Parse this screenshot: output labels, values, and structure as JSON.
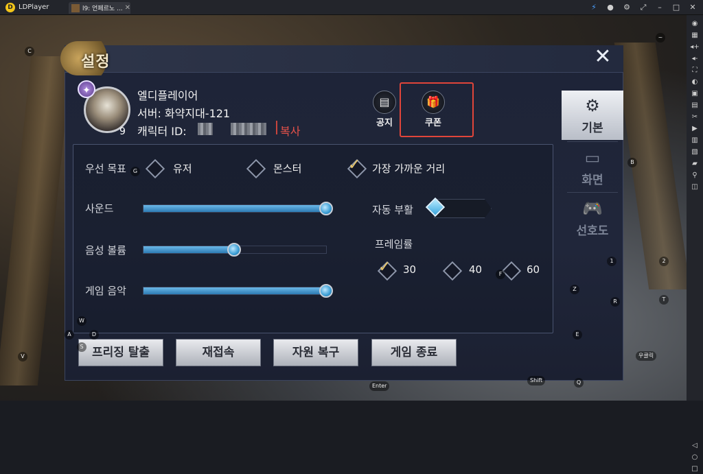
{
  "window": {
    "app_name": "LDPlayer",
    "tab_label": "l9: 언페르노 ...",
    "accent_color": "#f2c51a"
  },
  "toolbar_icons": [
    "lightning-icon",
    "user-icon",
    "settings-icon",
    "pin-icon",
    "minimize-icon",
    "maximize-icon",
    "close-icon"
  ],
  "settings": {
    "title": "설정",
    "close_symbol": "✕",
    "profile": {
      "name": "엘디플레이어",
      "server": "서버: 화약지대-121",
      "character_id_label": "캐릭터 ID:",
      "copy_label": "복사",
      "level": "9"
    },
    "top_buttons": {
      "notice": "공지",
      "coupon": "쿠폰"
    },
    "target_priority": {
      "label": "우선 목표",
      "options": [
        "유저",
        "몬스터",
        "가장 가까운 거리"
      ],
      "selected": "가장 가까운 거리"
    },
    "sound": {
      "label": "사운드",
      "value": 1.0
    },
    "voice_volume": {
      "label": "음성 볼륨",
      "value": 0.5
    },
    "game_music": {
      "label": "게임 음악",
      "value": 1.0
    },
    "auto_revive": {
      "label": "자동 부활",
      "enabled": false
    },
    "frame_rate": {
      "label": "프레임률",
      "options": [
        "30",
        "40",
        "60"
      ],
      "selected": "30"
    },
    "bottom_buttons": [
      "프리징 탈출",
      "재접속",
      "자원 복구",
      "게임 종료"
    ],
    "side_tabs": [
      {
        "label": "기본",
        "icon": "gear-icon",
        "active": true
      },
      {
        "label": "화면",
        "icon": "monitor-icon",
        "active": false
      },
      {
        "label": "선호도",
        "icon": "gamepad-icon",
        "active": false
      }
    ]
  },
  "key_hints": {
    "c": "C",
    "b": "B",
    "g": "G",
    "one": "1",
    "two": "2",
    "z": "Z",
    "r": "R",
    "t": "T",
    "f": "F",
    "w": "W",
    "a": "A",
    "d": "D",
    "s": "S",
    "v": "V",
    "e": "E",
    "q": "Q",
    "enter": "Enter",
    "shift": "Shift",
    "scroll": "우클릭",
    "tilde": "~"
  }
}
